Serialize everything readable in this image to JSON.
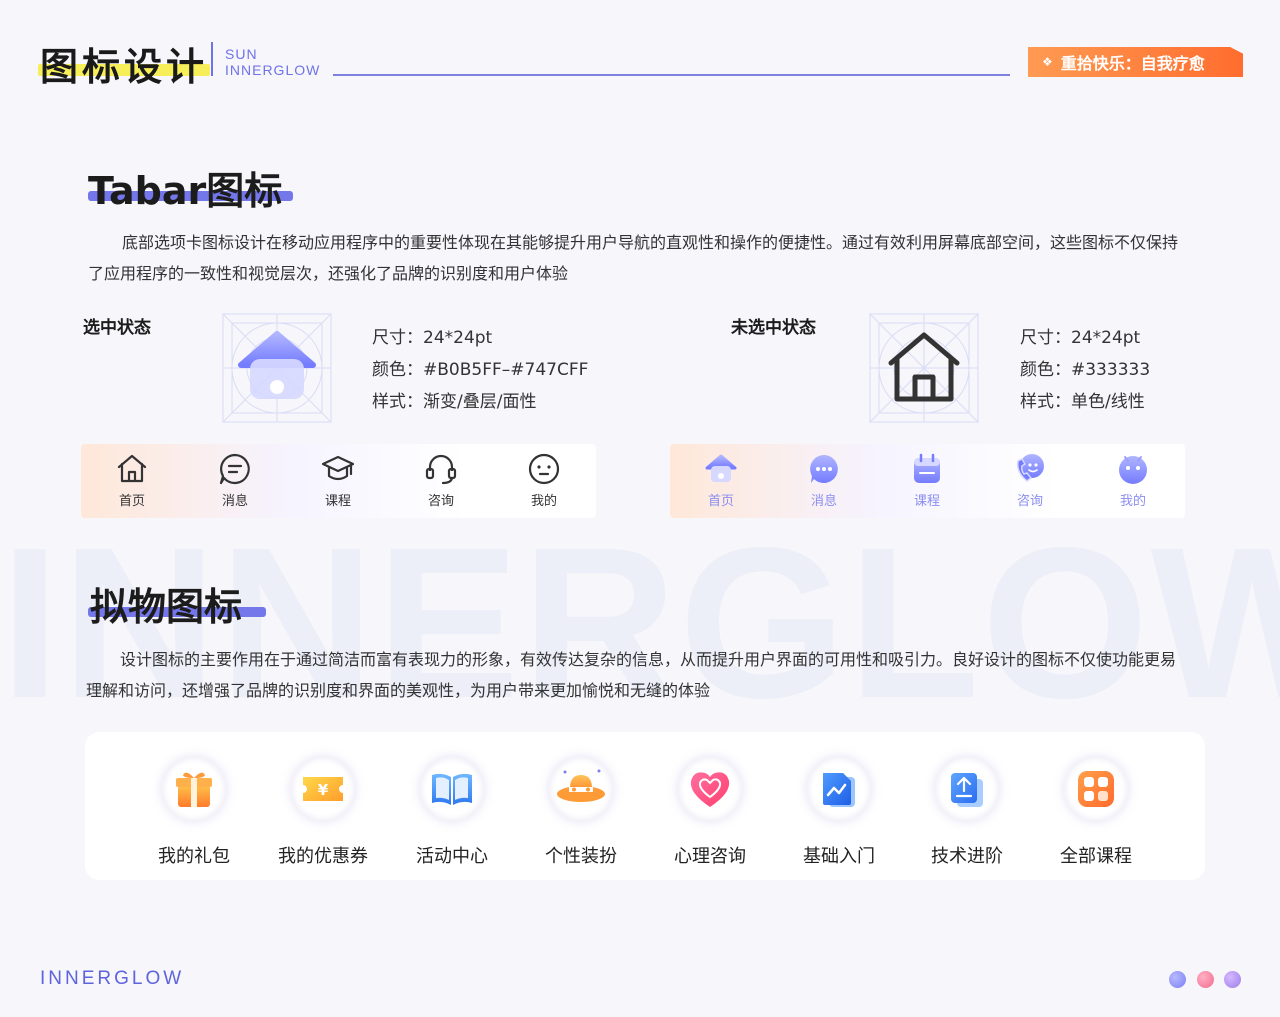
{
  "header": {
    "title": "图标设计",
    "sub_line1": "SUN",
    "sub_line2": "INNERGLOW",
    "badge_icon": "diamond-dots-icon",
    "badge": "重拾快乐：自我疗愈"
  },
  "watermark": "INNERGLOW",
  "tabar_section": {
    "title": "Tabar图标",
    "desc": "底部选项卡图标设计在移动应用程序中的重要性体现在其能够提升用户导航的直观性和操作的便捷性。通过有效利用屏幕底部空间，这些图标不仅保持了应用程序的一致性和视觉层次，还强化了品牌的识别度和用户体验",
    "selected": {
      "label": "选中状态",
      "size": "尺寸：24*24pt",
      "color": "颜色：#B0B5FF–#747CFF",
      "style": "样式：渐变/叠层/面性",
      "gradient_start": "#B0B5FF",
      "gradient_end": "#747CFF"
    },
    "unselected": {
      "label": "未选中状态",
      "size": "尺寸：24*24pt",
      "color": "颜色：#333333",
      "style": "样式：单色/线性",
      "stroke_color": "#333333"
    },
    "tabs": [
      {
        "label": "首页",
        "icon": "home-icon"
      },
      {
        "label": "消息",
        "icon": "message-icon"
      },
      {
        "label": "课程",
        "icon": "graduation-cap-icon"
      },
      {
        "label": "咨询",
        "icon": "headset-icon"
      },
      {
        "label": "我的",
        "icon": "smiley-icon"
      }
    ]
  },
  "skeuo_section": {
    "title": "拟物图标",
    "desc": "设计图标的主要作用在于通过简洁而富有表现力的形象，有效传达复杂的信息，从而提升用户界面的可用性和吸引力。良好设计的图标不仅使功能更易理解和访问，还增强了品牌的识别度和界面的美观性，为用户带来更加愉悦和无缝的体验",
    "items": [
      {
        "label": "我的礼包",
        "icon": "gift-icon"
      },
      {
        "label": "我的优惠券",
        "icon": "coupon-icon"
      },
      {
        "label": "活动中心",
        "icon": "open-book-icon"
      },
      {
        "label": "个性装扮",
        "icon": "hat-icon"
      },
      {
        "label": "心理咨询",
        "icon": "heart-icon"
      },
      {
        "label": "基础入门",
        "icon": "document-chart-icon"
      },
      {
        "label": "技术进阶",
        "icon": "document-upload-icon"
      },
      {
        "label": "全部课程",
        "icon": "grid-apps-icon"
      }
    ]
  },
  "footer": {
    "brand": "INNERGLOW",
    "dot_colors": [
      "#7b7ff0",
      "#f36a8e",
      "#9a7de8"
    ]
  }
}
